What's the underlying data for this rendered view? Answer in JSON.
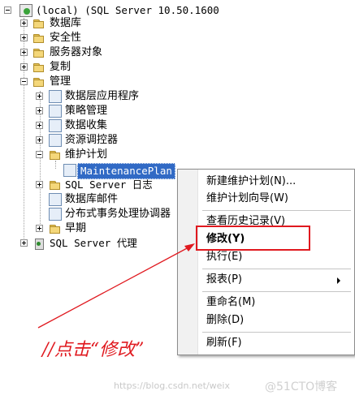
{
  "tree": {
    "root": "(local) (SQL Server 10.50.1600",
    "items": [
      {
        "label": "数据库"
      },
      {
        "label": "安全性"
      },
      {
        "label": "服务器对象"
      },
      {
        "label": "复制"
      },
      {
        "label": "管理"
      },
      {
        "label": "数据层应用程序"
      },
      {
        "label": "策略管理"
      },
      {
        "label": "数据收集"
      },
      {
        "label": "资源调控器"
      },
      {
        "label": "维护计划"
      },
      {
        "label": "MaintenancePlan"
      },
      {
        "label": "SQL Server 日志"
      },
      {
        "label": "数据库邮件"
      },
      {
        "label": "分布式事务处理协调器"
      },
      {
        "label": "早期"
      },
      {
        "label": "SQL Server 代理"
      }
    ]
  },
  "context_menu": {
    "items": [
      {
        "label": "新建维护计划(N)..."
      },
      {
        "label": "维护计划向导(W)"
      },
      {
        "label": "查看历史记录(V)"
      },
      {
        "label": "修改(Y)"
      },
      {
        "label": "执行(E)"
      },
      {
        "label": "报表(P)"
      },
      {
        "label": "重命名(M)"
      },
      {
        "label": "删除(D)"
      },
      {
        "label": "刷新(F)"
      }
    ]
  },
  "annotation": "//点击“修改”",
  "watermark": "https://blog.csdn.net/weix",
  "watermark2": "@51CTO博客",
  "colors": {
    "annotation_red": "#e0191f",
    "selection_blue": "#316ac5"
  }
}
